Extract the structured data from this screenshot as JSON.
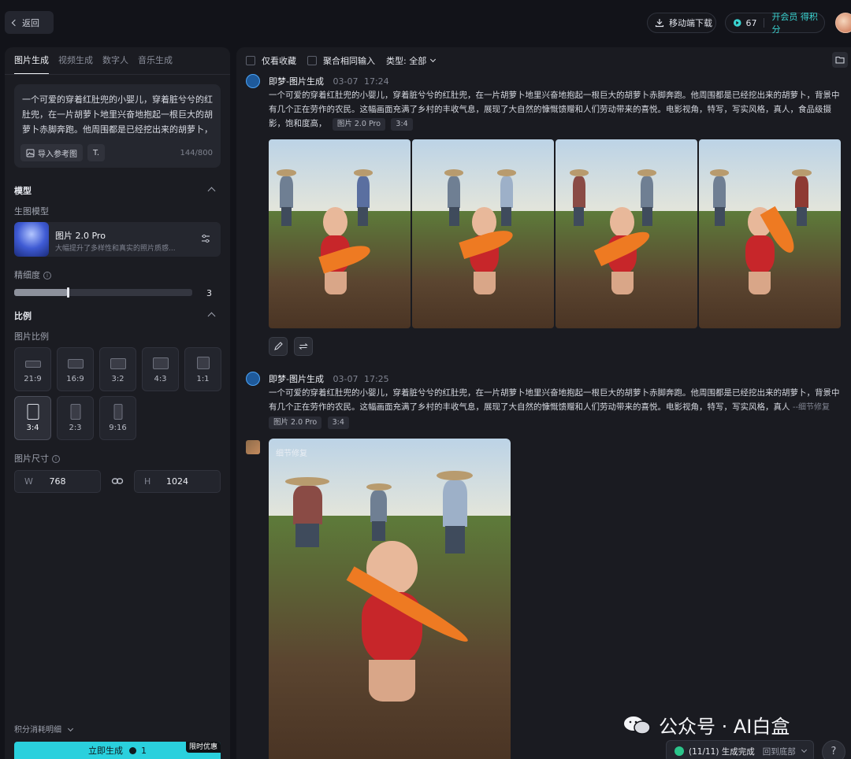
{
  "topbar": {
    "back_label": "返回",
    "download_label": "移动端下载",
    "points_value": "67",
    "vip_label": "开会员 得积分"
  },
  "left": {
    "tabs": [
      {
        "label": "图片生成"
      },
      {
        "label": "视频生成"
      },
      {
        "label": "数字人"
      },
      {
        "label": "音乐生成"
      }
    ],
    "prompt_text": "一个可爱的穿着红肚兜的小婴儿，穿着脏兮兮的红肚兜，在一片胡萝卜地里兴奋地抱起一根巨大的胡萝卜赤脚奔跑。他周围都是已经挖出来的胡萝卜，背景中有几个正在劳作的农民。这幅画面充满了乡",
    "import_ref_label": "导入参考图",
    "char_counter": "144/800",
    "model_section": "模型",
    "gen_model_label": "生图模型",
    "model_name": "图片 2.0 Pro",
    "model_desc": "大幅提升了多样性和真实的照片质感...",
    "detail_label": "精细度",
    "detail_value": "3",
    "detail_fraction": 0.3,
    "ratio_section": "比例",
    "ratio_label": "图片比例",
    "ratios": [
      {
        "label": "21:9"
      },
      {
        "label": "16:9"
      },
      {
        "label": "3:2"
      },
      {
        "label": "4:3"
      },
      {
        "label": "1:1"
      },
      {
        "label": "3:4"
      },
      {
        "label": "2:3"
      },
      {
        "label": "9:16"
      }
    ],
    "size_label": "图片尺寸",
    "width_prefix": "W",
    "width_value": "768",
    "height_prefix": "H",
    "height_value": "1024",
    "cost_label": "积分消耗明细",
    "generate_label": "立即生成",
    "generate_cost": "1",
    "promo_label": "限时优惠"
  },
  "main": {
    "filter_fav": "仅看收藏",
    "filter_merge": "聚合相同输入",
    "filter_type": "类型: 全部",
    "entries": [
      {
        "source": "即梦-图片生成",
        "date": "03-07",
        "time": "17:24",
        "text": "一个可爱的穿着红肚兜的小婴儿，穿着脏兮兮的红肚兜，在一片胡萝卜地里兴奋地抱起一根巨大的胡萝卜赤脚奔跑。他周围都是已经挖出来的胡萝卜，背景中有几个正在劳作的农民。这幅画面充满了乡村的丰收气息，展现了大自然的慷慨馈赠和人们劳动带来的喜悦。电影视角，特写，写实风格，真人，食品级摄影，饱和度高，",
        "tag_model": "图片 2.0 Pro",
        "tag_ratio": "3:4"
      },
      {
        "source": "即梦-图片生成",
        "date": "03-07",
        "time": "17:25",
        "text": "一个可爱的穿着红肚兜的小婴儿，穿着脏兮兮的红肚兜，在一片胡萝卜地里兴奋地抱起一根巨大的胡萝卜赤脚奔跑。他周围都是已经挖出来的胡萝卜，背景中有几个正在劳作的农民。这幅画面充满了乡村的丰收气息，展现了大自然的慷慨馈赠和人们劳动带来的喜悦。电影视角，特写，写实风格，真人",
        "fix_link": "--细节修复",
        "tag_model": "图片 2.0 Pro",
        "tag_ratio": "3:4",
        "image_label": "细节修复"
      }
    ],
    "status_text": "(11/11) 生成完成",
    "status_back": "回到底部",
    "help_label": "?"
  },
  "watermark": "公众号 · AI白盒",
  "colors": {
    "accent": "#2ad0dd",
    "vest": "#c7262a",
    "carrot": "#ee7a22",
    "success": "#2bc48a"
  }
}
